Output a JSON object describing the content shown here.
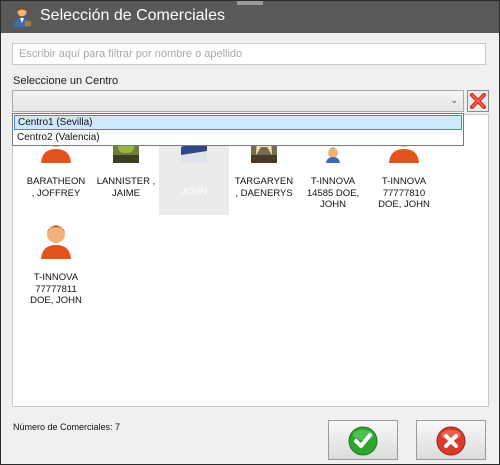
{
  "window": {
    "title": "Selección de Comerciales",
    "icons": [
      "salesperson-app-icon"
    ]
  },
  "filter": {
    "placeholder": "Escribir aquí para filtrar por nombre o apellido",
    "value": ""
  },
  "center": {
    "label": "Seleccione un Centro",
    "selected_value": "",
    "options": [
      "Centro1 (Sevilla)",
      "Centro2 (Valencia)"
    ],
    "highlighted_option": "Centro1 (Sevilla)"
  },
  "sales_reps": [
    {
      "name": "BARATHEON\n, JOFFREY",
      "icon": "person-avatar-icon"
    },
    {
      "name": "LANNISTER ,\nJAIME",
      "icon": "photo-thumbnail"
    },
    {
      "name": "JOHN",
      "icon": "photo-thumbnail",
      "selected": true
    },
    {
      "name": "TARGARYEN\n, DAENERYS",
      "icon": "photo-thumbnail"
    },
    {
      "name": "T-INNOVA\n14585 DOE,\nJOHN",
      "icon": "person-small-icon"
    },
    {
      "name": "T-INNOVA\n77777810\nDOE, JOHN",
      "icon": "person-avatar-icon"
    },
    {
      "name": "T-INNOVA\n77777811\nDOE, JOHN",
      "icon": "person-avatar-icon"
    }
  ],
  "footer": {
    "count_text": "Número de Comerciales: 7"
  },
  "buttons": {
    "ok_icon": "green-check-icon",
    "cancel_icon": "red-x-icon"
  },
  "colors": {
    "titlebar": "#595959",
    "selection": "#cde8ff",
    "ok": "#2fa52f",
    "cancel": "#d93a2a"
  }
}
